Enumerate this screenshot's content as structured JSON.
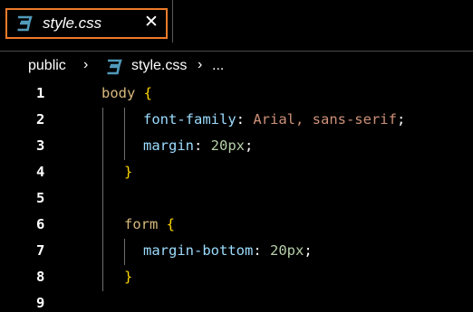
{
  "tab": {
    "label": "style.css",
    "close": "✕",
    "icon": "css3-icon",
    "active_border_color": "#ef7b2a"
  },
  "breadcrumb": {
    "folder": "public",
    "file": "style.css",
    "trailing": "...",
    "separator": "›"
  },
  "editor": {
    "lines": [
      {
        "number": "1",
        "tokens": [
          {
            "t": "body ",
            "c": "sel"
          },
          {
            "t": "{",
            "c": "brace"
          }
        ]
      },
      {
        "number": "2",
        "tokens": [
          {
            "t": "font-family",
            "c": "prop"
          },
          {
            "t": ": ",
            "c": "punc"
          },
          {
            "t": "Arial, sans-serif",
            "c": "val"
          },
          {
            "t": ";",
            "c": "punc"
          }
        ]
      },
      {
        "number": "3",
        "tokens": [
          {
            "t": "margin",
            "c": "prop"
          },
          {
            "t": ": ",
            "c": "punc"
          },
          {
            "t": "20px",
            "c": "num"
          },
          {
            "t": ";",
            "c": "punc"
          }
        ]
      },
      {
        "number": "4",
        "tokens": [
          {
            "t": "}",
            "c": "brace"
          }
        ]
      },
      {
        "number": "5",
        "tokens": []
      },
      {
        "number": "6",
        "tokens": [
          {
            "t": "form ",
            "c": "sel"
          },
          {
            "t": "{",
            "c": "brace"
          }
        ]
      },
      {
        "number": "7",
        "tokens": [
          {
            "t": "margin-bottom",
            "c": "prop"
          },
          {
            "t": ": ",
            "c": "punc"
          },
          {
            "t": "20px",
            "c": "num"
          },
          {
            "t": ";",
            "c": "punc"
          }
        ]
      },
      {
        "number": "8",
        "tokens": [
          {
            "t": "}",
            "c": "brace"
          }
        ]
      },
      {
        "number": "9",
        "tokens": []
      }
    ]
  },
  "colors": {
    "selector": "#d7ba7d",
    "brace": "#ffd700",
    "property": "#9cdcfe",
    "value": "#ce9178",
    "number": "#b5cea8",
    "css_icon": "#519aba"
  }
}
